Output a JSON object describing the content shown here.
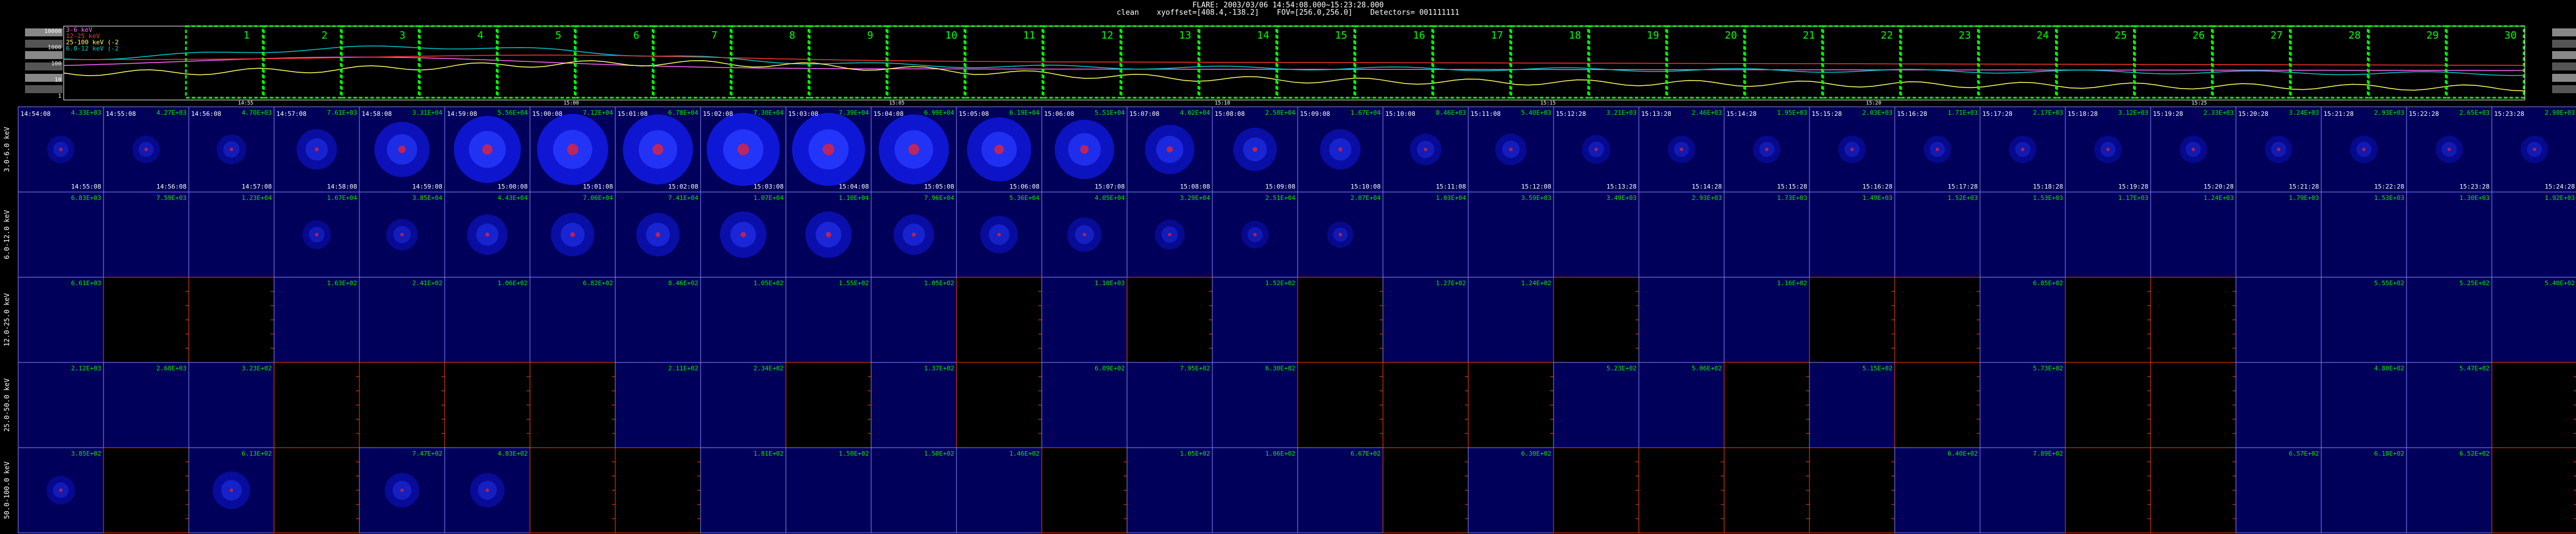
{
  "header": {
    "line1": "FLARE: 2003/03/06 14:54:08.000~15:23:28.000",
    "line2": "clean    xyoffset=[408.4,-138.2]    FOV=[256.0,256.0]    Detectors= 001111111"
  },
  "lightcurve": {
    "y_ticks": [
      "10000",
      "1000",
      "100",
      "10",
      "1"
    ],
    "legend": [
      {
        "text": "3-6 keV",
        "color": "#ff66ff"
      },
      {
        "text": "12-25 keV",
        "color": "#ff3333"
      },
      {
        "text": "25-100 keV (-2",
        "color": "#ffff66"
      },
      {
        "text": "6.0-12 keV (-2",
        "color": "#00cccc"
      }
    ],
    "x_ticks": [
      "14:55",
      "15:00",
      "15:05",
      "15:10",
      "15:15",
      "15:20",
      "15:25"
    ],
    "interval_labels": [
      "1",
      "2",
      "3",
      "4",
      "5",
      "6",
      "7",
      "8",
      "9",
      "10",
      "11",
      "12",
      "13",
      "14",
      "15",
      "16",
      "17",
      "18",
      "19",
      "20",
      "21",
      "22",
      "23",
      "24",
      "25",
      "26",
      "27",
      "28",
      "29",
      "30"
    ],
    "colors": {
      "bands_box": "#00ff00",
      "band_3_6": "#ff66ff",
      "band_12_25": "#ff3333",
      "band_25_100": "#ffff66",
      "band_6_12": "#00cccc"
    }
  },
  "rows": [
    {
      "label": "3.0-6.0 keV",
      "peaks": [
        "4.33E+03",
        "4.27E+03",
        "4.70E+03",
        "7.61E+03",
        "3.31E+04",
        "5.56E+04",
        "7.12E+04",
        "6.78E+04",
        "7.30E+04",
        "7.39E+04",
        "6.99E+04",
        "6.19E+04",
        "5.51E+04",
        "4.02E+04",
        "2.50E+04",
        "1.67E+04",
        "8.46E+03",
        "5.40E+03",
        "3.21E+03",
        "2.46E+03",
        "1.95E+03",
        "2.03E+03",
        "1.71E+03",
        "2.17E+03",
        "3.12E+03",
        "2.33E+03",
        "3.24E+03",
        "2.93E+03",
        "2.65E+03",
        "2.98E+03"
      ],
      "starts": [
        "14:54:08",
        "14:55:08",
        "14:56:08",
        "14:57:08",
        "14:58:08",
        "14:59:08",
        "15:00:08",
        "15:01:08",
        "15:02:08",
        "15:03:08",
        "15:04:08",
        "15:05:08",
        "15:06:08",
        "15:07:08",
        "15:08:08",
        "15:09:08",
        "15:10:08",
        "15:11:08",
        "15:12:28",
        "15:13:28",
        "15:14:28",
        "15:15:28",
        "15:16:28",
        "15:17:28",
        "15:18:28",
        "15:19:28",
        "15:20:28",
        "15:21:28",
        "15:22:28",
        "15:23:28"
      ],
      "ends": [
        "14:55:08",
        "14:56:08",
        "14:57:08",
        "14:58:08",
        "14:59:08",
        "15:00:08",
        "15:01:08",
        "15:02:08",
        "15:03:08",
        "15:04:08",
        "15:05:08",
        "15:06:08",
        "15:07:08",
        "15:08:08",
        "15:09:08",
        "15:10:08",
        "15:11:08",
        "15:12:08",
        "15:13:28",
        "15:14:28",
        "15:15:28",
        "15:16:28",
        "15:17:28",
        "15:18:28",
        "15:19:28",
        "15:20:28",
        "15:21:28",
        "15:22:28",
        "15:23:28",
        "15:24:28"
      ],
      "img": [
        0.08,
        0.08,
        0.12,
        0.3,
        0.55,
        0.75,
        0.82,
        0.8,
        0.85,
        0.85,
        0.8,
        0.7,
        0.62,
        0.45,
        0.35,
        0.3,
        0.15,
        0.15,
        0.1,
        0.08,
        0.08,
        0.08,
        0.08,
        0.08,
        0.08,
        0.08,
        0.08,
        0.08,
        0.08,
        0.08
      ],
      "filled": [
        1,
        1,
        1,
        1,
        1,
        1,
        1,
        1,
        1,
        1,
        1,
        1,
        1,
        1,
        1,
        1,
        1,
        1,
        1,
        1,
        1,
        1,
        1,
        1,
        1,
        1,
        1,
        1,
        1,
        1
      ]
    },
    {
      "label": "6.0-12.0 keV",
      "peaks": [
        "6.83E+03",
        "7.59E+03",
        "1.23E+04",
        "1.67E+04",
        "3.85E+04",
        "4.43E+04",
        "7.06E+04",
        "7.41E+04",
        "1.07E+04",
        "1.10E+04",
        "7.96E+04",
        "5.36E+04",
        "4.05E+04",
        "3.29E+04",
        "2.51E+04",
        "2.07E+04",
        "1.03E+04",
        "3.59E+03",
        "3.49E+03",
        "2.93E+03",
        "1.73E+03",
        "1.49E+03",
        "1.52E+03",
        "1.53E+03",
        "1.17E+03",
        "1.24E+03",
        "1.79E+03",
        "1.53E+03",
        "1.30E+03",
        "1.92E+03"
      ],
      "img": [
        0.05,
        0.05,
        0.05,
        0.1,
        0.15,
        0.3,
        0.35,
        0.35,
        0.4,
        0.4,
        0.3,
        0.25,
        0.2,
        0.12,
        0.08,
        0.06,
        0.05,
        0.05,
        0.05,
        0.05,
        0.05,
        0.05,
        0.05,
        0.05,
        0.05,
        0.05,
        0.05,
        0.05,
        0.05,
        0.05
      ],
      "filled": [
        1,
        1,
        1,
        1,
        1,
        1,
        1,
        1,
        1,
        1,
        1,
        1,
        1,
        1,
        1,
        1,
        1,
        1,
        1,
        1,
        1,
        1,
        1,
        1,
        1,
        1,
        1,
        1,
        1,
        1
      ]
    },
    {
      "label": "12.0-25.0 keV",
      "peaks": [
        "6.61E+03",
        "",
        "",
        "1.63E+02",
        "2.41E+02",
        "1.06E+02",
        "6.82E+02",
        "8.46E+02",
        "1.05E+02",
        "1.55E+02",
        "1.05E+02",
        "",
        "1.10E+03",
        "",
        "1.52E+02",
        "",
        "1.27E+02",
        "1.24E+02",
        "",
        "",
        "1.16E+02",
        "",
        "",
        "6.85E+02",
        "",
        "",
        "",
        "5.55E+02",
        "5.25E+02",
        "5.40E+02"
      ],
      "img": [
        0.04,
        0,
        0,
        0.04,
        0.04,
        0.04,
        0.04,
        0.04,
        0.04,
        0.04,
        0.04,
        0,
        0.04,
        0,
        0.04,
        0,
        0.04,
        0.04,
        0,
        0.04,
        0.04,
        0,
        0,
        0.04,
        0,
        0,
        0.04,
        0.04,
        0.04,
        0.04
      ],
      "filled": [
        1,
        0,
        0,
        1,
        1,
        1,
        1,
        1,
        1,
        1,
        1,
        0,
        1,
        0,
        1,
        0,
        1,
        1,
        0,
        1,
        1,
        0,
        0,
        1,
        0,
        0,
        1,
        1,
        1,
        1
      ]
    },
    {
      "label": "25.0-50.0 keV",
      "peaks": [
        "2.12E+03",
        "2.68E+03",
        "3.23E+02",
        "",
        "",
        "",
        "",
        "2.11E+02",
        "2.34E+02",
        "",
        "1.37E+02",
        "",
        "6.09E+02",
        "7.95E+02",
        "6.30E+02",
        "",
        "",
        "",
        "5.23E+02",
        "5.06E+02",
        "",
        "5.15E+02",
        "",
        "5.73E+02",
        "",
        "",
        "",
        "4.80E+02",
        "5.47E+02",
        ""
      ],
      "img": [
        0.04,
        0.04,
        0.04,
        0,
        0,
        0,
        0,
        0.04,
        0.04,
        0,
        0.04,
        0,
        0.04,
        0.04,
        0.04,
        0,
        0,
        0,
        0.04,
        0.04,
        0,
        0.04,
        0,
        0.04,
        0,
        0,
        0.04,
        0.04,
        0.04,
        0
      ],
      "filled": [
        1,
        1,
        1,
        0,
        0,
        0,
        0,
        1,
        1,
        0,
        1,
        0,
        1,
        1,
        1,
        0,
        0,
        0,
        1,
        1,
        0,
        1,
        0,
        1,
        0,
        0,
        1,
        1,
        1,
        0
      ]
    },
    {
      "label": "50.0-100.0 keV",
      "peaks": [
        "3.85E+02",
        "",
        "6.13E+02",
        "",
        "7.47E+02",
        "4.83E+02",
        "",
        "",
        "1.81E+02",
        "1.50E+02",
        "1.50E+02",
        "1.46E+02",
        "",
        "1.05E+02",
        "1.06E+02",
        "6.67E+02",
        "",
        "6.30E+02",
        "",
        "",
        "",
        "",
        "6.40E+02",
        "7.89E+02",
        "",
        "",
        "6.57E+02",
        "6.18E+02",
        "6.52E+02",
        ""
      ],
      "img": [
        0.1,
        0,
        0.25,
        0,
        0.2,
        0.2,
        0,
        0,
        0.04,
        0.04,
        0.04,
        0.04,
        0,
        0.04,
        0.04,
        0.04,
        0,
        0.04,
        0,
        0,
        0,
        0,
        0.04,
        0.04,
        0,
        0,
        0.04,
        0.04,
        0.04,
        0
      ],
      "filled": [
        1,
        0,
        1,
        0,
        1,
        1,
        0,
        0,
        1,
        1,
        1,
        1,
        0,
        1,
        1,
        1,
        0,
        1,
        0,
        0,
        0,
        0,
        1,
        1,
        0,
        0,
        1,
        1,
        1,
        0
      ]
    }
  ],
  "colors": {
    "frame_blue": "#ffffff",
    "frame_red": "#ff4400",
    "peak_text": "#00ee00",
    "image_bg": "#00005a",
    "source_core": "#ff2020",
    "source_ring": "#2020ff"
  }
}
